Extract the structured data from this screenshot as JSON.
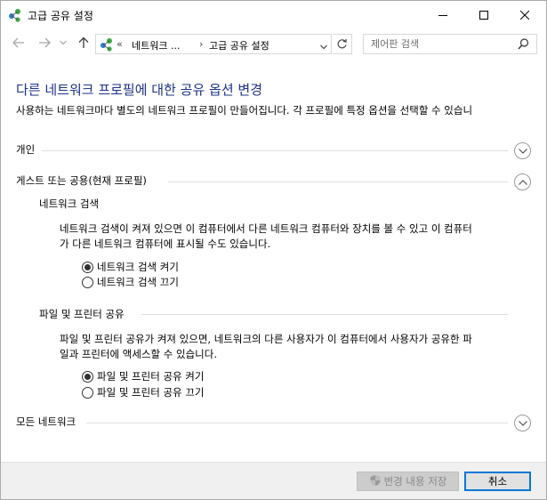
{
  "window": {
    "title": "고급 공유 설정"
  },
  "nav": {
    "breadcrumb_chevron": "«",
    "crumbs": [
      "네트워크 ...",
      "고급 공유 설정"
    ],
    "crumb_separator": "›",
    "search_placeholder": "제어판 검색"
  },
  "main": {
    "title": "다른 네트워크 프로필에 대한 공유 옵션 변경",
    "description": "사용하는 네트워크마다 별도의 네트워크 프로필이 만들어집니다. 각 프로필에 특정 옵션을 선택할 수 있습니",
    "sections": [
      {
        "label": "개인",
        "expanded": false
      },
      {
        "label": "게스트 또는 공용(현재 프로필)",
        "expanded": true,
        "subsections": [
          {
            "label": "네트워크 검색",
            "text_line1": "네트워크 검색이 켜져 있으면 이 컴퓨터에서 다른 네트워크 컴퓨터와 장치를 볼 수 있고 이 컴퓨터",
            "text_line2": "가 다른 네트워크 컴퓨터에 표시될 수도 있습니다.",
            "options": [
              {
                "label": "네트워크 검색 켜기",
                "selected": true
              },
              {
                "label": "네트워크 검색 끄기",
                "selected": false
              }
            ]
          },
          {
            "label": "파일 및 프린터 공유",
            "text_line1": "파일 및 프린터 공유가 켜져 있으면, 네트워크의 다른 사용자가 이 컴퓨터에서 사용자가 공유한 파",
            "text_line2": "일과 프린터에 액세스할 수 있습니다.",
            "options": [
              {
                "label": "파일 및 프린터 공유 켜기",
                "selected": true
              },
              {
                "label": "파일 및 프린터 공유 끄기",
                "selected": false
              }
            ]
          }
        ]
      },
      {
        "label": "모든 네트워크",
        "expanded": false
      }
    ]
  },
  "footer": {
    "save_label": "변경 내용 저장",
    "cancel_label": "취소"
  },
  "colors": {
    "title_blue": "#1e3287",
    "accent": "#0078d7"
  }
}
